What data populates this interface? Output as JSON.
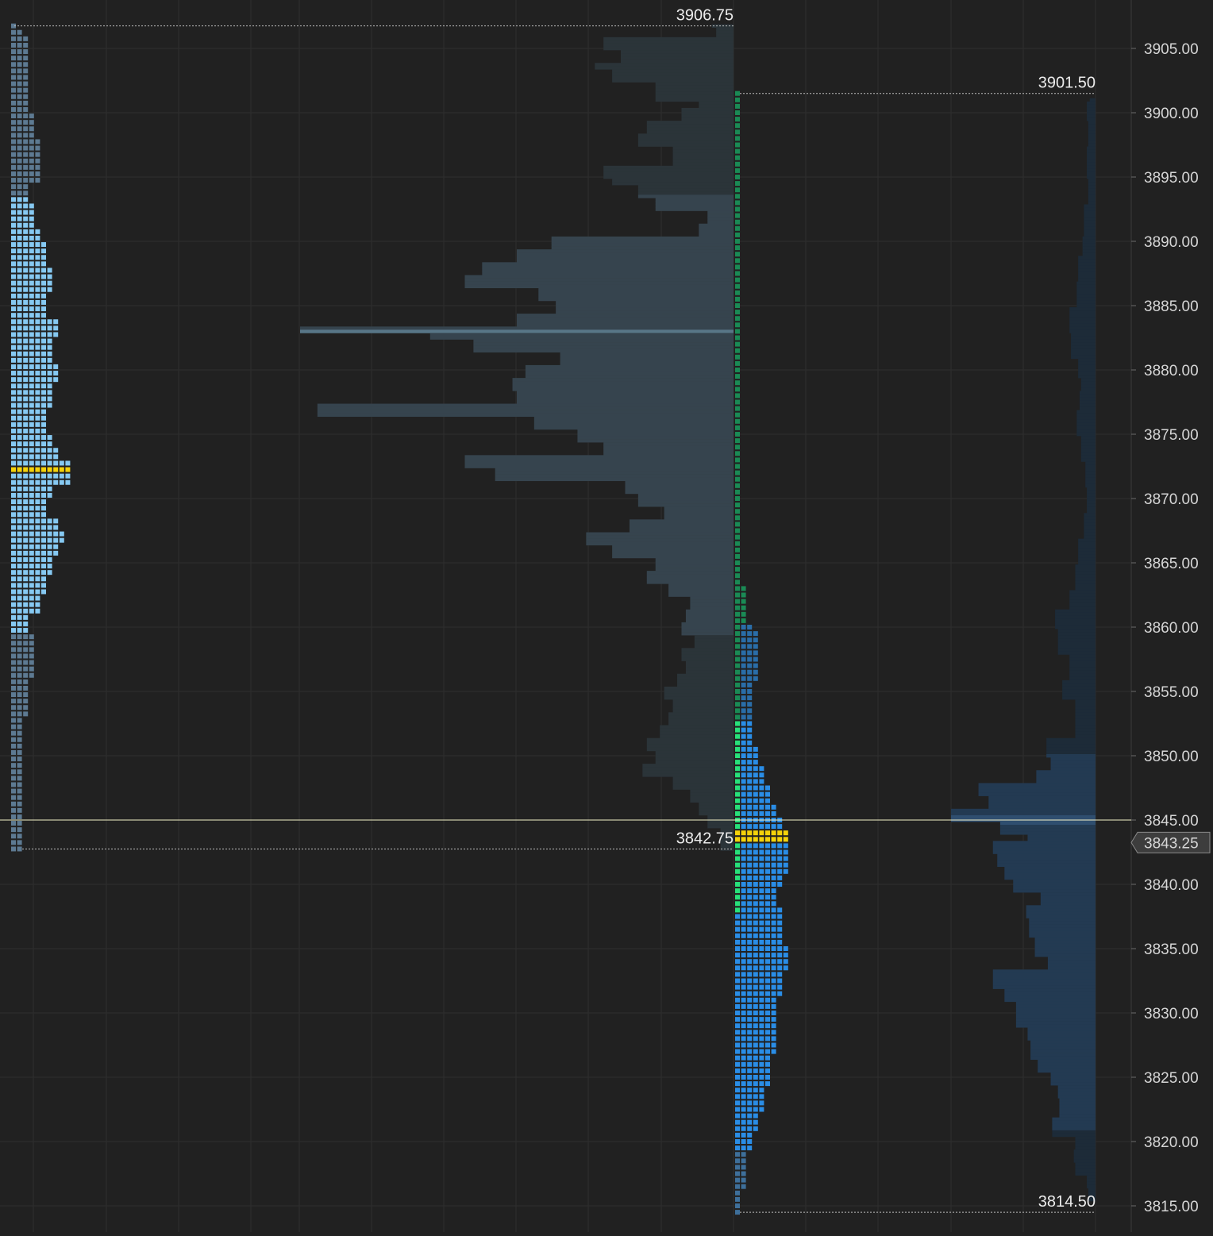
{
  "chart_data": {
    "type": "market_profile",
    "price_axis": {
      "min": 3814.5,
      "max": 3906.75,
      "tick_step": 5,
      "tick_labels": [
        "3905.00",
        "3900.00",
        "3895.00",
        "3890.00",
        "3885.00",
        "3880.00",
        "3875.00",
        "3870.00",
        "3865.00",
        "3860.00",
        "3855.00",
        "3850.00",
        "3845.00",
        "3840.00",
        "3835.00",
        "3830.00",
        "3825.00",
        "3820.00",
        "3815.00"
      ],
      "grid": true
    },
    "current_price": {
      "value": 3843.25,
      "label": "3843.25"
    },
    "crosshair_price": 3845.0,
    "colors": {
      "background": "#212121",
      "grid": "#2e2e2e",
      "prior_tpo": "#5d7a92",
      "prior_tpo_value_area": "#86c9f2",
      "prior_volume": "#3b4e5c",
      "current_tpo_upper": "#1a8a55",
      "current_tpo_value_area": "#2a8de6",
      "current_tpo_low": "#3e6f9a",
      "current_tpo_open": "#27e07a",
      "poc": "#f5d20a",
      "current_volume": "#233a52"
    },
    "profiles": [
      {
        "name": "prior-session",
        "high": {
          "value": 3906.75,
          "label": "3906.75"
        },
        "low": {
          "value": 3842.75,
          "label": "3842.75"
        },
        "tpo_poc": 3872.25,
        "volume_poc": 3883.0,
        "value_area_high": 3893.5,
        "value_area_low": 3859.5,
        "tpo_shape": [
          [
            3906.75,
            1
          ],
          [
            3906.0,
            2
          ],
          [
            3904.5,
            3
          ],
          [
            3900.0,
            3
          ],
          [
            3898.0,
            4
          ],
          [
            3896.5,
            5
          ],
          [
            3894.5,
            5
          ],
          [
            3893.25,
            3
          ],
          [
            3891.0,
            4
          ],
          [
            3890.0,
            5
          ],
          [
            3888.0,
            6
          ],
          [
            3886.0,
            7
          ],
          [
            3884.0,
            6
          ],
          [
            3882.5,
            8
          ],
          [
            3880.5,
            7
          ],
          [
            3879.0,
            8
          ],
          [
            3877.0,
            7
          ],
          [
            3875.0,
            6
          ],
          [
            3874.0,
            7
          ],
          [
            3873.0,
            8
          ],
          [
            3872.25,
            10
          ],
          [
            3871.0,
            10
          ],
          [
            3870.0,
            7
          ],
          [
            3868.5,
            6
          ],
          [
            3867.5,
            8
          ],
          [
            3866.5,
            9
          ],
          [
            3865.5,
            8
          ],
          [
            3864.0,
            7
          ],
          [
            3862.5,
            6
          ],
          [
            3861.0,
            5
          ],
          [
            3859.5,
            3
          ],
          [
            3857.5,
            4
          ],
          [
            3856.0,
            4
          ],
          [
            3853.0,
            3
          ],
          [
            3850.5,
            2
          ],
          [
            3847.0,
            2
          ],
          [
            3844.0,
            2
          ],
          [
            3842.75,
            2
          ]
        ],
        "volume_shape": [
          [
            3906.75,
            0.05
          ],
          [
            3906.0,
            0.04
          ],
          [
            3905.0,
            0.3
          ],
          [
            3904.0,
            0.26
          ],
          [
            3903.5,
            0.32
          ],
          [
            3902.5,
            0.28
          ],
          [
            3901.0,
            0.18
          ],
          [
            3900.5,
            0.08
          ],
          [
            3899.5,
            0.12
          ],
          [
            3898.5,
            0.2
          ],
          [
            3897.5,
            0.22
          ],
          [
            3896.0,
            0.14
          ],
          [
            3895.0,
            0.3
          ],
          [
            3894.5,
            0.28
          ],
          [
            3893.5,
            0.22
          ],
          [
            3892.5,
            0.18
          ],
          [
            3891.5,
            0.06
          ],
          [
            3890.5,
            0.08
          ],
          [
            3889.5,
            0.42
          ],
          [
            3888.5,
            0.5
          ],
          [
            3887.5,
            0.58
          ],
          [
            3886.5,
            0.62
          ],
          [
            3885.5,
            0.45
          ],
          [
            3884.5,
            0.41
          ],
          [
            3883.5,
            0.5
          ],
          [
            3883.0,
            1.0
          ],
          [
            3882.5,
            0.7
          ],
          [
            3881.5,
            0.6
          ],
          [
            3880.5,
            0.4
          ],
          [
            3879.5,
            0.48
          ],
          [
            3878.5,
            0.51
          ],
          [
            3877.5,
            0.5
          ],
          [
            3876.5,
            0.96
          ],
          [
            3875.5,
            0.46
          ],
          [
            3874.5,
            0.36
          ],
          [
            3873.5,
            0.3
          ],
          [
            3872.5,
            0.62
          ],
          [
            3871.5,
            0.55
          ],
          [
            3870.5,
            0.25
          ],
          [
            3869.5,
            0.22
          ],
          [
            3868.5,
            0.16
          ],
          [
            3867.5,
            0.24
          ],
          [
            3866.5,
            0.34
          ],
          [
            3865.5,
            0.28
          ],
          [
            3864.5,
            0.18
          ],
          [
            3863.5,
            0.2
          ],
          [
            3862.5,
            0.15
          ],
          [
            3861.5,
            0.1
          ],
          [
            3860.5,
            0.11
          ],
          [
            3859.5,
            0.12
          ],
          [
            3858.5,
            0.09
          ],
          [
            3857.5,
            0.12
          ],
          [
            3856.5,
            0.11
          ],
          [
            3855.5,
            0.13
          ],
          [
            3854.5,
            0.16
          ],
          [
            3853.5,
            0.14
          ],
          [
            3852.5,
            0.15
          ],
          [
            3851.5,
            0.17
          ],
          [
            3850.5,
            0.2
          ],
          [
            3849.5,
            0.18
          ],
          [
            3848.5,
            0.21
          ],
          [
            3847.5,
            0.14
          ],
          [
            3846.5,
            0.1
          ],
          [
            3845.5,
            0.08
          ],
          [
            3844.5,
            0.06
          ],
          [
            3843.25,
            0.03
          ]
        ]
      },
      {
        "name": "current-session",
        "high": {
          "value": 3901.5,
          "label": "3901.50"
        },
        "low": {
          "value": 3814.5,
          "label": "3814.50"
        },
        "tpo_poc": 3843.75,
        "volume_poc": 3845.0,
        "open_range": [
          3838.0,
          3852.5
        ],
        "value_area_high": 3852.5,
        "value_area_low": 3819.5,
        "tpo_shape": [
          [
            3901.5,
            1
          ],
          [
            3891.0,
            1
          ],
          [
            3876.0,
            1
          ],
          [
            3863.5,
            1
          ],
          [
            3862.5,
            2
          ],
          [
            3860.5,
            2
          ],
          [
            3860.0,
            3
          ],
          [
            3858.0,
            4
          ],
          [
            3856.0,
            4
          ],
          [
            3852.5,
            3
          ],
          [
            3851.0,
            3
          ],
          [
            3849.5,
            4
          ],
          [
            3848.0,
            5
          ],
          [
            3846.5,
            6
          ],
          [
            3845.5,
            7
          ],
          [
            3844.5,
            8
          ],
          [
            3843.75,
            9
          ],
          [
            3842.5,
            9
          ],
          [
            3841.0,
            9
          ],
          [
            3840.0,
            8
          ],
          [
            3838.5,
            7
          ],
          [
            3837.5,
            8
          ],
          [
            3835.5,
            8
          ],
          [
            3833.5,
            9
          ],
          [
            3831.5,
            8
          ],
          [
            3829.5,
            7
          ],
          [
            3827.0,
            7
          ],
          [
            3824.5,
            6
          ],
          [
            3822.5,
            5
          ],
          [
            3821.0,
            4
          ],
          [
            3819.5,
            3
          ],
          [
            3818.0,
            2
          ],
          [
            3816.5,
            2
          ],
          [
            3815.5,
            1
          ],
          [
            3814.5,
            1
          ]
        ],
        "volume_shape": [
          [
            3901.0,
            0.04
          ],
          [
            3899.5,
            0.06
          ],
          [
            3897.5,
            0.05
          ],
          [
            3895.0,
            0.06
          ],
          [
            3893.0,
            0.05
          ],
          [
            3890.5,
            0.08
          ],
          [
            3889.0,
            0.09
          ],
          [
            3887.0,
            0.12
          ],
          [
            3885.0,
            0.13
          ],
          [
            3883.0,
            0.18
          ],
          [
            3881.0,
            0.17
          ],
          [
            3879.5,
            0.12
          ],
          [
            3878.5,
            0.1
          ],
          [
            3877.0,
            0.11
          ],
          [
            3875.0,
            0.13
          ],
          [
            3873.0,
            0.1
          ],
          [
            3871.0,
            0.07
          ],
          [
            3869.0,
            0.06
          ],
          [
            3867.0,
            0.08
          ],
          [
            3865.0,
            0.12
          ],
          [
            3863.0,
            0.14
          ],
          [
            3861.5,
            0.18
          ],
          [
            3860.0,
            0.28
          ],
          [
            3858.0,
            0.26
          ],
          [
            3856.0,
            0.18
          ],
          [
            3854.5,
            0.23
          ],
          [
            3853.0,
            0.14
          ],
          [
            3851.5,
            0.14
          ],
          [
            3850.0,
            0.34
          ],
          [
            3849.0,
            0.31
          ],
          [
            3848.0,
            0.41
          ],
          [
            3847.0,
            0.81
          ],
          [
            3846.0,
            0.74
          ],
          [
            3845.0,
            1.0
          ],
          [
            3844.0,
            0.66
          ],
          [
            3843.5,
            0.47
          ],
          [
            3842.5,
            0.71
          ],
          [
            3841.5,
            0.68
          ],
          [
            3840.5,
            0.63
          ],
          [
            3839.5,
            0.57
          ],
          [
            3838.5,
            0.38
          ],
          [
            3837.5,
            0.48
          ],
          [
            3836.0,
            0.46
          ],
          [
            3834.5,
            0.42
          ],
          [
            3833.5,
            0.33
          ],
          [
            3832.0,
            0.71
          ],
          [
            3831.0,
            0.63
          ],
          [
            3830.0,
            0.55
          ],
          [
            3829.0,
            0.55
          ],
          [
            3828.0,
            0.47
          ],
          [
            3826.5,
            0.45
          ],
          [
            3825.5,
            0.4
          ],
          [
            3824.5,
            0.31
          ],
          [
            3823.5,
            0.26
          ],
          [
            3822.0,
            0.25
          ],
          [
            3820.5,
            0.3
          ],
          [
            3819.5,
            0.14
          ],
          [
            3818.5,
            0.15
          ],
          [
            3817.5,
            0.14
          ],
          [
            3816.5,
            0.06
          ],
          [
            3815.5,
            0.05
          ]
        ]
      }
    ]
  }
}
